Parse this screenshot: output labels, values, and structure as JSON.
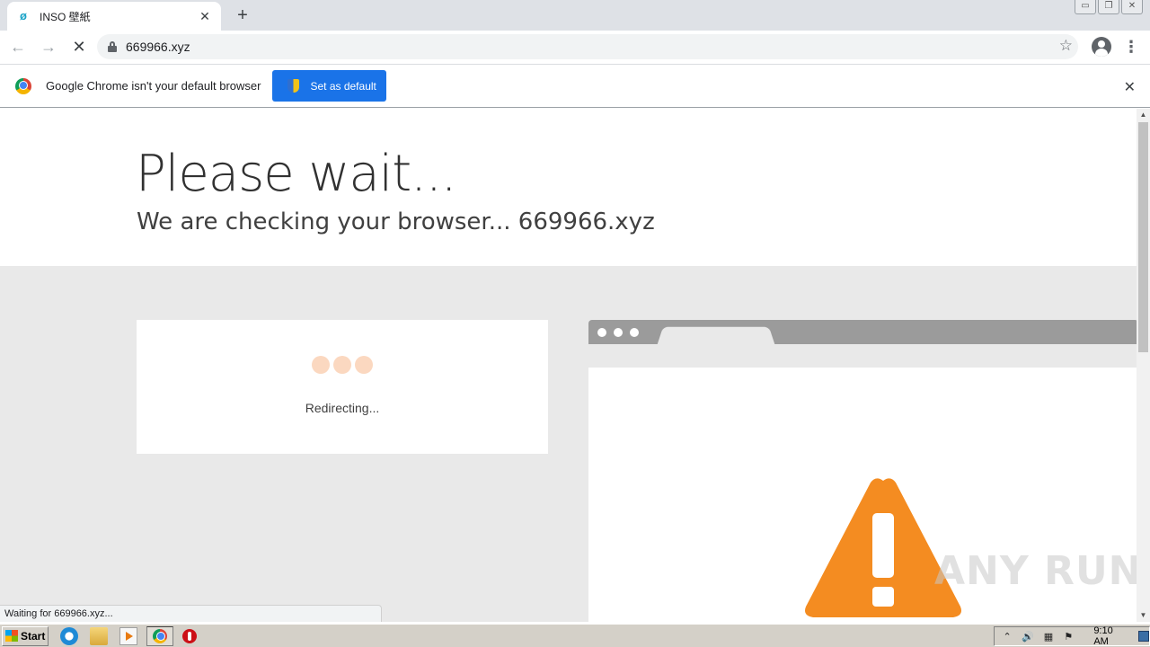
{
  "browser": {
    "tab_title": "INSO 壁紙",
    "url": "669966.xyz",
    "new_tab_symbol": "+",
    "close_symbol": "✕",
    "back_symbol": "←",
    "forward_symbol": "→",
    "reload_symbol": "✕",
    "star_symbol": "☆",
    "menu_symbol": "⋮",
    "window_controls": [
      "▭",
      "❐",
      "✕"
    ]
  },
  "infobar": {
    "message": "Google Chrome isn't your default browser",
    "button_label": "Set as default",
    "close_symbol": "✕"
  },
  "page": {
    "title": "Please wait...",
    "subtitle": "We are checking your browser... 669966.xyz",
    "status_text": "Redirecting...",
    "warning_color": "#f48c21",
    "dot_color": "#fbd8c0"
  },
  "statusbar": {
    "text": "Waiting for 669966.xyz..."
  },
  "watermark": {
    "text": "ANY RUN"
  },
  "taskbar": {
    "start_label": "Start",
    "clock": "9:10 AM",
    "tray_glyphs": [
      "⌃",
      "🔊",
      "▦",
      "⚑"
    ]
  },
  "icons": {
    "tab_favicon": "globe-icon",
    "lock": "lock-icon",
    "warning": "warning-triangle-icon"
  }
}
